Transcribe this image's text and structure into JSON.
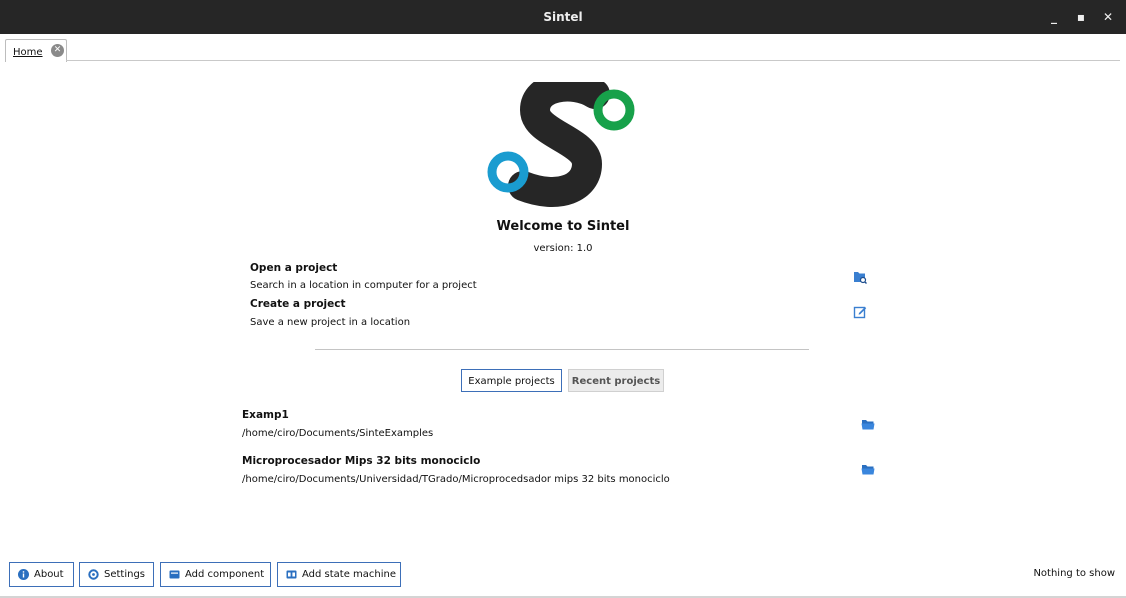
{
  "window": {
    "title": "Sintel",
    "controls": [
      "_",
      "▪",
      "✕"
    ]
  },
  "tabs": [
    {
      "label": "Home",
      "closable": true
    }
  ],
  "welcome": {
    "heading": "Welcome to Sintel",
    "version": "version: 1.0"
  },
  "actions": [
    {
      "title": "Open a project",
      "description": "Search in a location in computer for a project",
      "icon": "folder-search-icon"
    },
    {
      "title": "Create a project",
      "description": "Save a new project in a location",
      "icon": "new-document-icon"
    }
  ],
  "project_tabs": {
    "example": "Example projects",
    "recent": "Recent projects",
    "selected": "example"
  },
  "projects": [
    {
      "name": "Examp1",
      "path": "/home/ciro/Documents/SinteExamples",
      "icon": "folder-open-icon"
    },
    {
      "name": "Microprocesador Mips 32 bits monociclo",
      "path": "/home/ciro/Documents/Universidad/TGrado/Microprocedsador mips 32 bits monociclo",
      "icon": "folder-open-icon"
    }
  ],
  "footer": {
    "buttons": [
      {
        "label": "About",
        "icon": "info-icon"
      },
      {
        "label": "Settings",
        "icon": "gear-icon"
      },
      {
        "label": "Add component",
        "icon": "component-icon"
      },
      {
        "label": "Add state machine",
        "icon": "state-machine-icon"
      }
    ],
    "status": "Nothing to show"
  },
  "colors": {
    "accent": "#3d6fb8",
    "logo_dark": "#262626",
    "logo_green": "#17a14a",
    "logo_blue": "#1a9cd0",
    "titlebar": "#262626"
  }
}
